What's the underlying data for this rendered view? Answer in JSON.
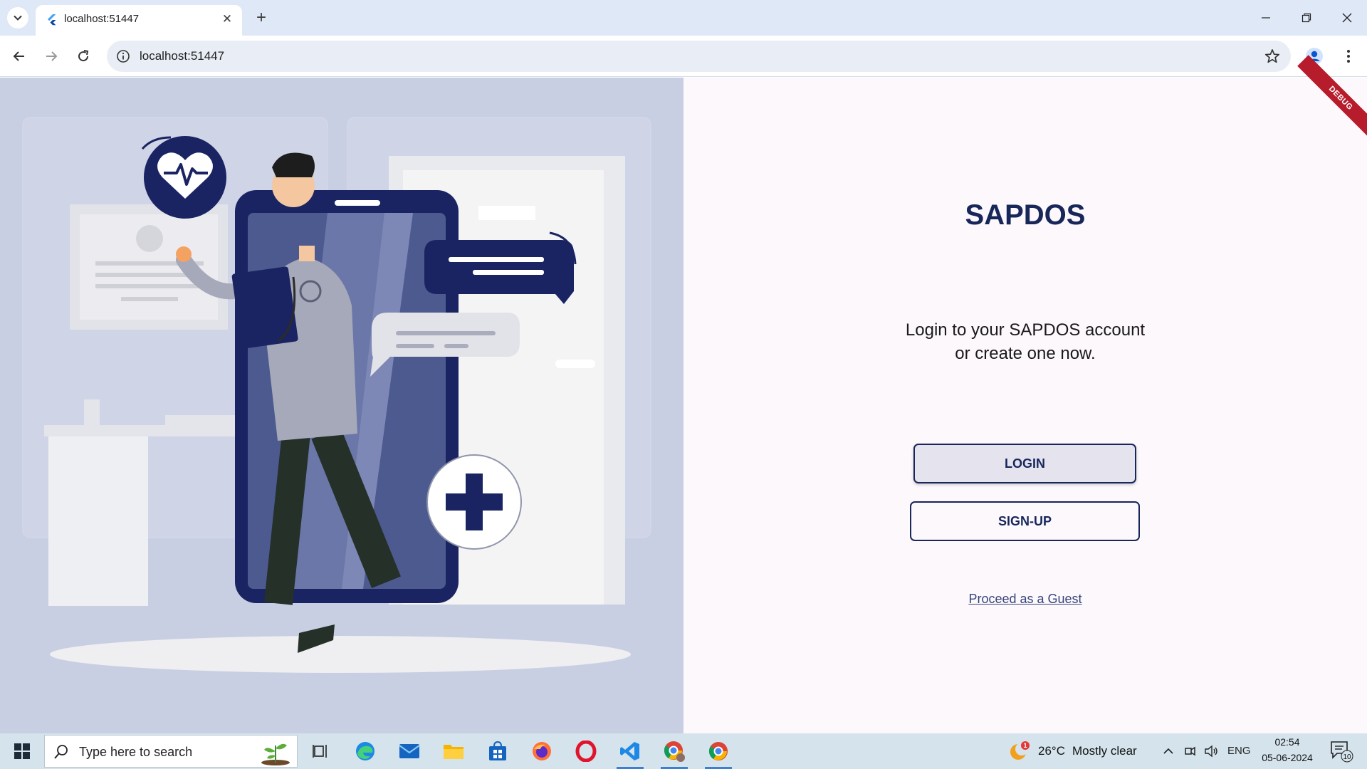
{
  "browser": {
    "tab_title": "localhost:51447",
    "url": "localhost:51447"
  },
  "page": {
    "debug_label": "DEBUG",
    "app_title": "SAPDOS",
    "tagline_line1": "Login to your SAPDOS account",
    "tagline_line2": "or create one now.",
    "login_label": "LOGIN",
    "signup_label": "SIGN-UP",
    "guest_link": "Proceed as a Guest"
  },
  "taskbar": {
    "search_placeholder": "Type here to search",
    "weather_badge": "1",
    "temperature": "26°C",
    "weather_condition": "Mostly clear",
    "language": "ENG",
    "time": "02:54",
    "date": "05-06-2024",
    "notification_count": "10"
  },
  "colors": {
    "brand_navy": "#17275a",
    "illustration_bg": "#c9cfe3",
    "page_bg": "#fdf8fc",
    "debug_banner": "#b71c2c"
  }
}
